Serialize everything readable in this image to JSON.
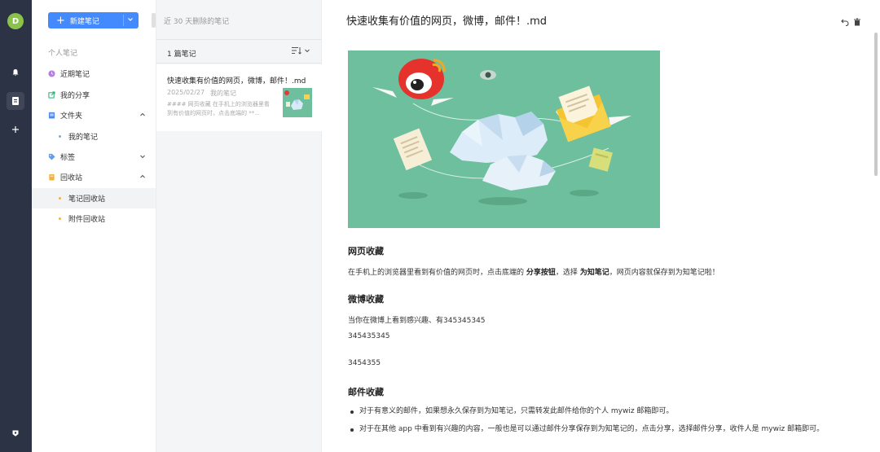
{
  "avatar": {
    "initial": "D"
  },
  "sidebar": {
    "new_note_label": "新建笔记",
    "section_title": "个人笔记",
    "items": [
      {
        "label": "近期笔记",
        "icon": "clock-icon",
        "color": "#b37fe0"
      },
      {
        "label": "我的分享",
        "icon": "share-icon",
        "color": "#2db87d"
      },
      {
        "label": "文件夹",
        "icon": "folder-icon",
        "color": "#4d8af0"
      },
      {
        "label": "我的笔记",
        "icon": "dot-icon",
        "color": "#8fa6c7"
      },
      {
        "label": "标签",
        "icon": "tag-icon",
        "color": "#6a9be8"
      },
      {
        "label": "回收站",
        "icon": "trash-icon",
        "color": "#f3b23c"
      },
      {
        "label": "笔记回收站",
        "icon": "dot-icon",
        "color": "#f3b23c"
      },
      {
        "label": "附件回收站",
        "icon": "dot-icon",
        "color": "#f3b23c"
      }
    ]
  },
  "list": {
    "title": "近 30 天删除的笔记",
    "count": "1 篇笔记",
    "note": {
      "title": "快速收集有价值的网页，微博，邮件！.md",
      "date": "2025/02/27",
      "folder": "我的笔记",
      "snippet": "#### 网页收藏 在手机上的浏览器里看到有价值的网页时，点击底端的 **..."
    }
  },
  "editor": {
    "title": "快速收集有价值的网页，微博，邮件！.md",
    "h_web": "网页收藏",
    "p_web_1": "在手机上的浏览器里看到有价值的网页时，点击底端的 ",
    "p_web_b1": "分享按钮",
    "p_web_2": "，选择 ",
    "p_web_b2": "为知笔记",
    "p_web_3": "，网页内容就保存到为知笔记啦！",
    "h_weibo": "微博收藏",
    "p_weibo": "当你在微博上看到感兴趣、有345345345",
    "p_num1": "345435345",
    "p_num2": "3454355",
    "h_mail": "邮件收藏",
    "li_1": "对于有意义的邮件，如果想永久保存到为知笔记，只需转发此邮件给你的个人 mywiz 邮箱即可。",
    "li_2": "对于在其他 app 中看到有兴趣的内容，一般也是可以通过邮件分享保存到为知笔记的，点击分享，选择邮件分享，收件人是 mywiz 邮箱即可。"
  },
  "colors": {
    "accent": "#448aff",
    "rail": "#2b3344",
    "hero_bg": "#6dbf9d"
  }
}
